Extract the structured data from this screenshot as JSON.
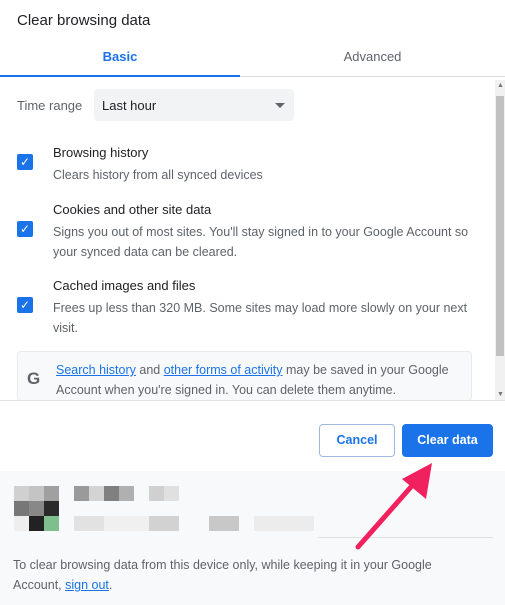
{
  "dialog": {
    "title": "Clear browsing data"
  },
  "tabs": [
    {
      "label": "Basic",
      "active": true
    },
    {
      "label": "Advanced",
      "active": false
    }
  ],
  "time_range": {
    "label": "Time range",
    "value": "Last hour"
  },
  "options": [
    {
      "title": "Browsing history",
      "desc": "Clears history from all synced devices",
      "checked": true
    },
    {
      "title": "Cookies and other site data",
      "desc": "Signs you out of most sites. You'll stay signed in to your Google Account so your synced data can be cleared.",
      "checked": true
    },
    {
      "title": "Cached images and files",
      "desc": "Frees up less than 320 MB. Some sites may load more slowly on your next visit.",
      "checked": true
    }
  ],
  "google_notice": {
    "icon": "google-g-icon",
    "letter": "G",
    "link1": "Search history",
    "and": " and ",
    "link2": "other forms of activity",
    "rest": " may be saved in your Google Account when you're signed in. You can delete them anytime."
  },
  "buttons": {
    "cancel": "Cancel",
    "clear": "Clear data"
  },
  "footer": {
    "text": "To clear browsing data from this device only, while keeping it in your Google Account, ",
    "link": "sign out",
    "end": "."
  },
  "colors": {
    "accent": "#1a73e8",
    "annotation_arrow": "#f0215e"
  }
}
